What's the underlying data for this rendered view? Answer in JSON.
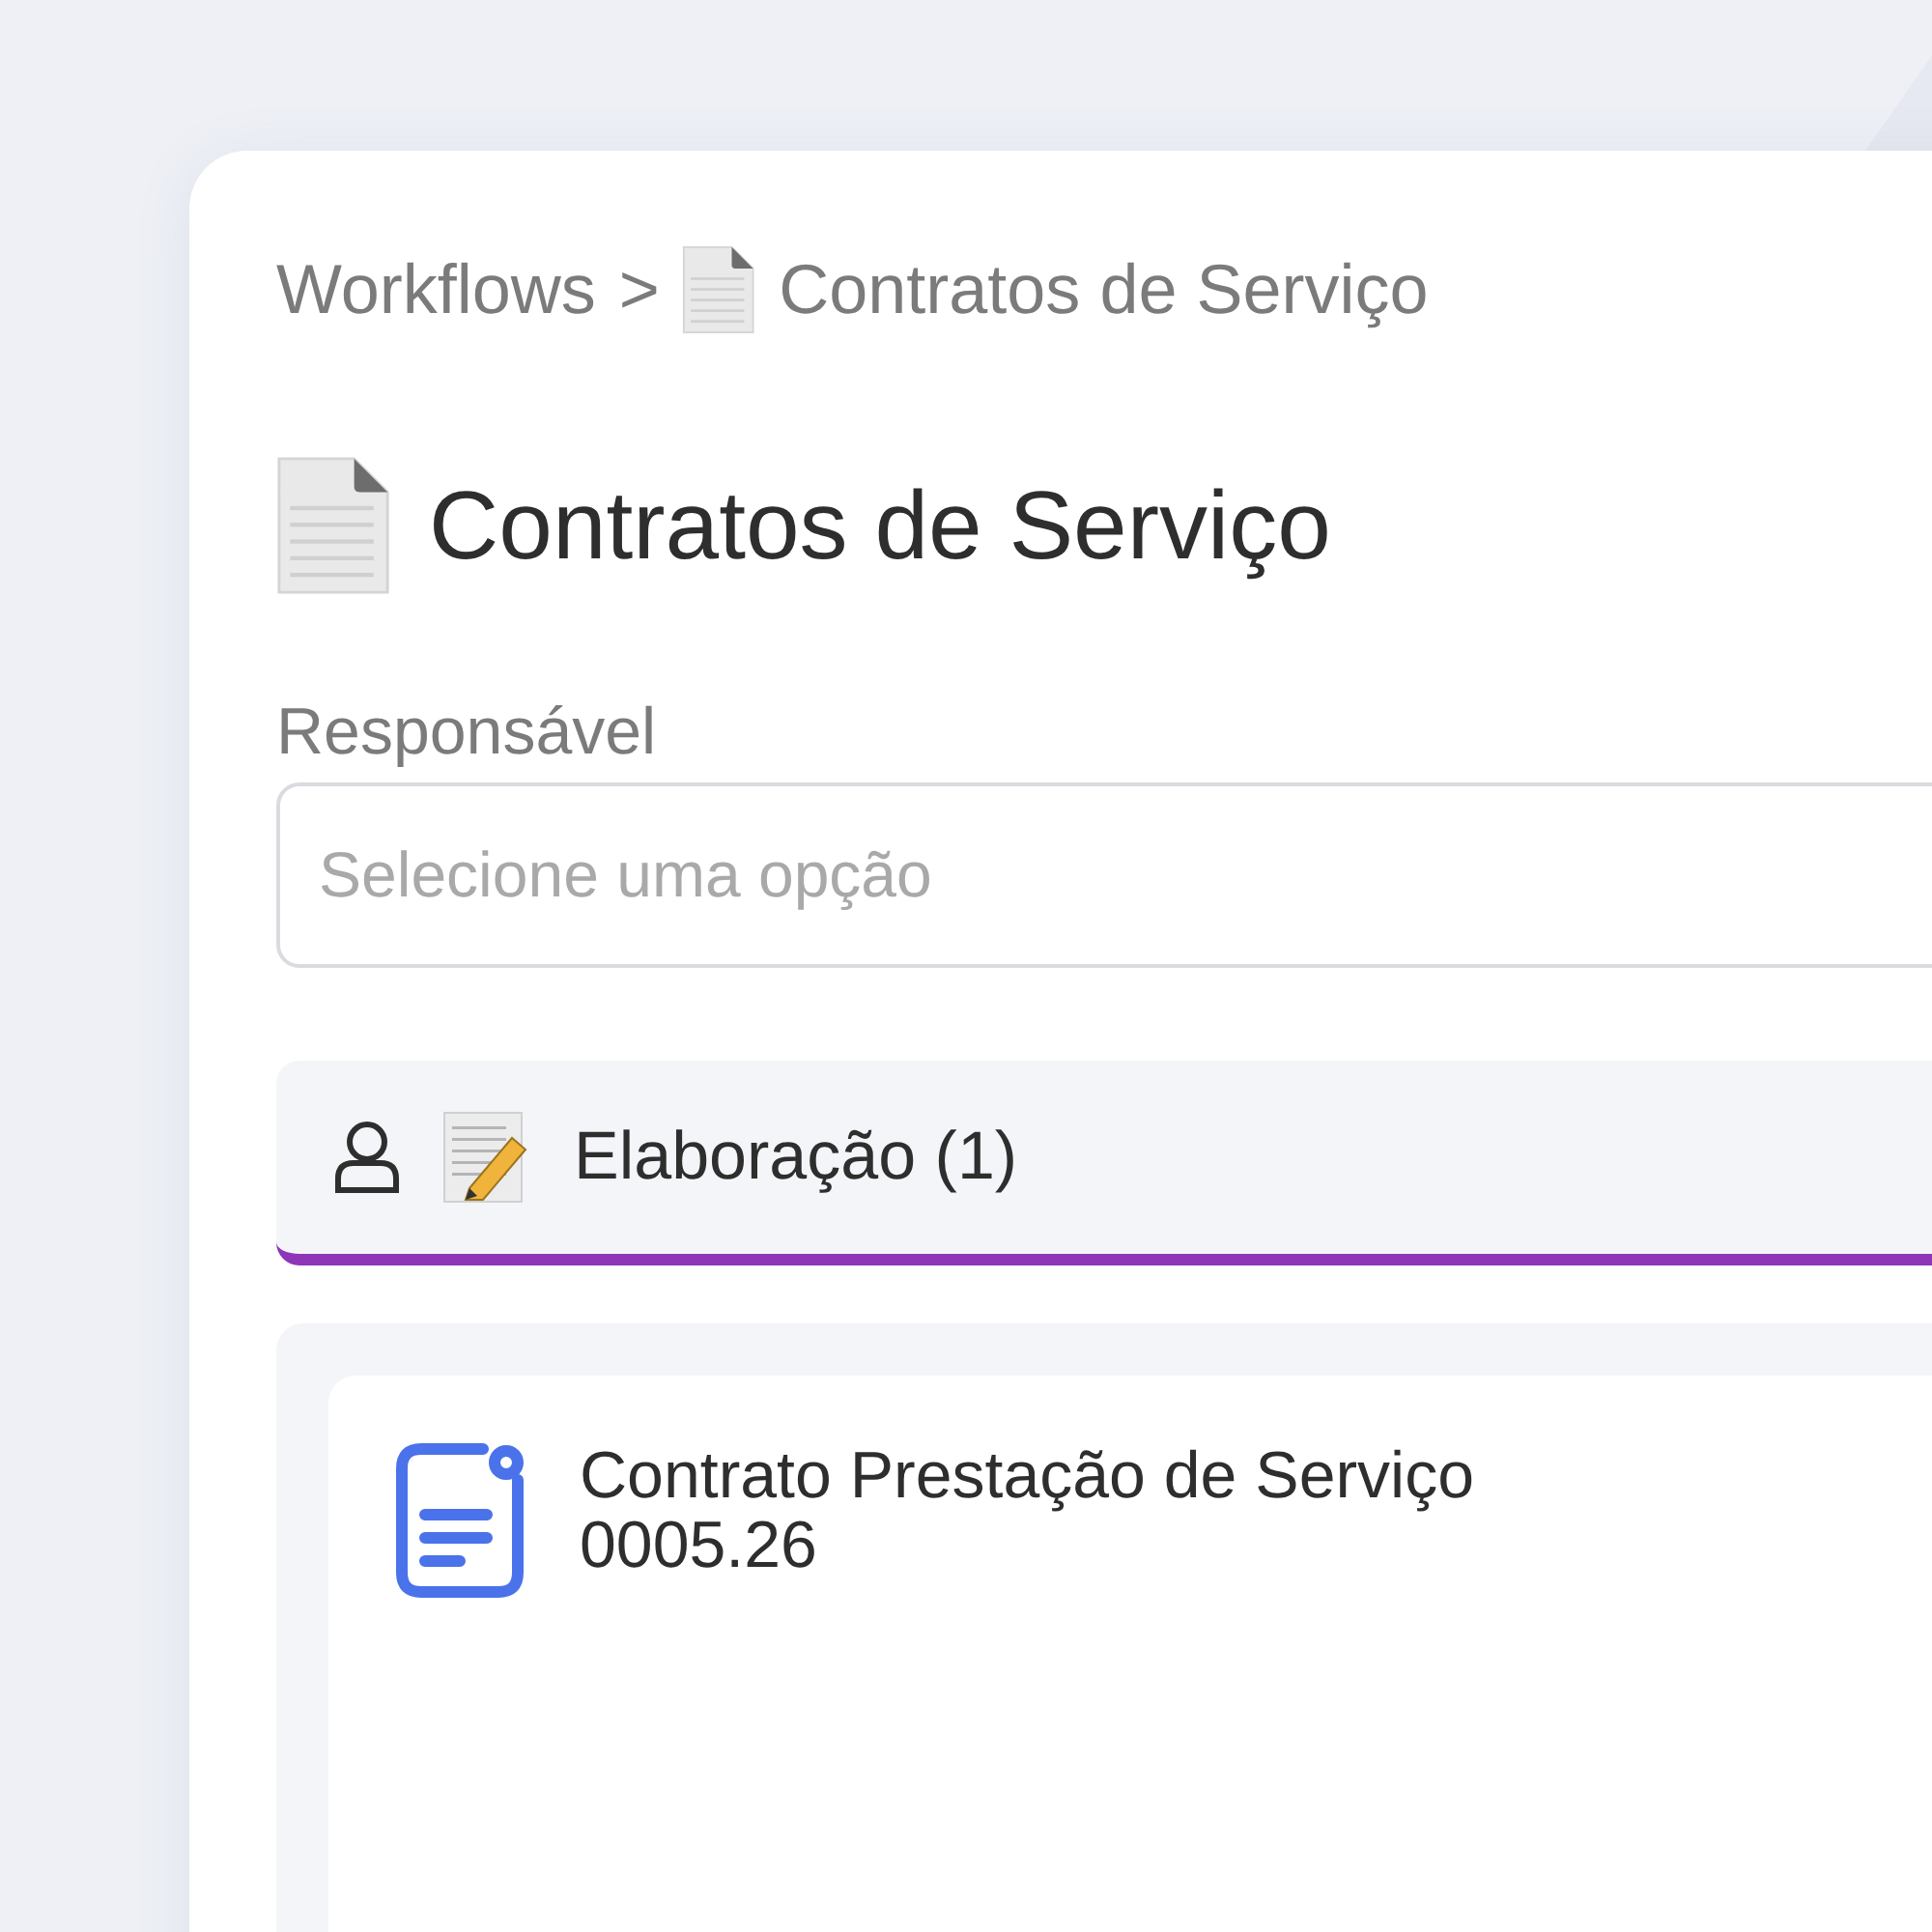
{
  "breadcrumb": {
    "items": [
      "Workflows",
      "Contratos de Serviço"
    ],
    "separator": ">"
  },
  "title": "Contratos de Serviço",
  "field": {
    "label": "Responsável",
    "placeholder": "Selecione uma opção"
  },
  "column": {
    "title": "Elaboração (1)",
    "cards": [
      {
        "title": "Contrato Prestação de Serviço 0005.26"
      }
    ]
  }
}
